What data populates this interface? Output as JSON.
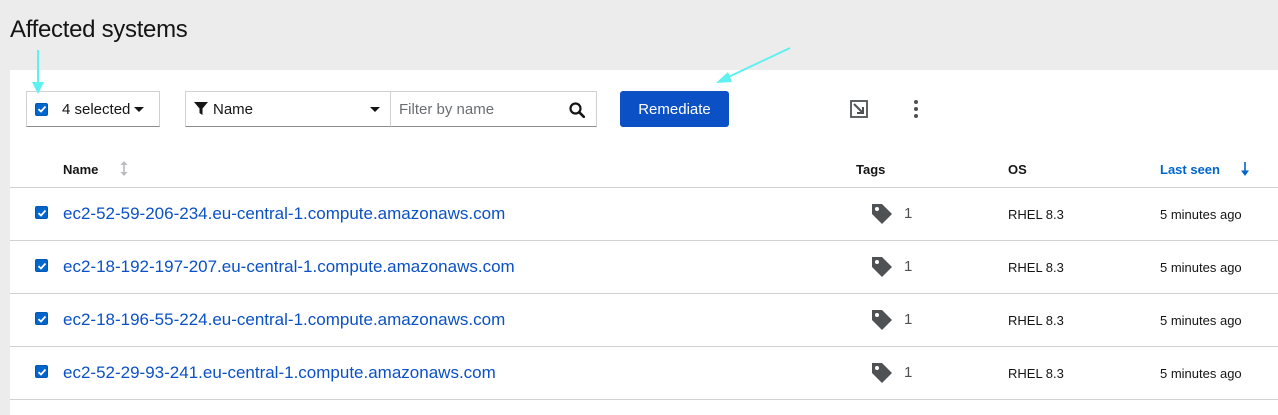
{
  "page": {
    "title": "Affected systems"
  },
  "toolbar": {
    "bulk_select_label": "4 selected",
    "filter_type_label": "Name",
    "filter_placeholder": "Filter by name",
    "remediate_label": "Remediate"
  },
  "table": {
    "columns": [
      "Name",
      "Tags",
      "OS",
      "Last seen"
    ],
    "rows": [
      {
        "name": "ec2-52-59-206-234.eu-central-1.compute.amazonaws.com",
        "tags": "1",
        "os": "RHEL 8.3",
        "last_seen": "5 minutes ago"
      },
      {
        "name": "ec2-18-192-197-207.eu-central-1.compute.amazonaws.com",
        "tags": "1",
        "os": "RHEL 8.3",
        "last_seen": "5 minutes ago"
      },
      {
        "name": "ec2-18-196-55-224.eu-central-1.compute.amazonaws.com",
        "tags": "1",
        "os": "RHEL 8.3",
        "last_seen": "5 minutes ago"
      },
      {
        "name": "ec2-52-29-93-241.eu-central-1.compute.amazonaws.com",
        "tags": "1",
        "os": "RHEL 8.3",
        "last_seen": "5 minutes ago"
      }
    ]
  },
  "colors": {
    "primary": "#0b51c5",
    "link": "#0066cc",
    "annotation_arrow": "#5ff0f0",
    "header_bg": "#ececec"
  },
  "icons": [
    "checkbox-icon",
    "filter-icon",
    "search-icon",
    "export-icon",
    "kebab-icon",
    "sort-icon",
    "sort-down-icon",
    "tag-icon"
  ]
}
